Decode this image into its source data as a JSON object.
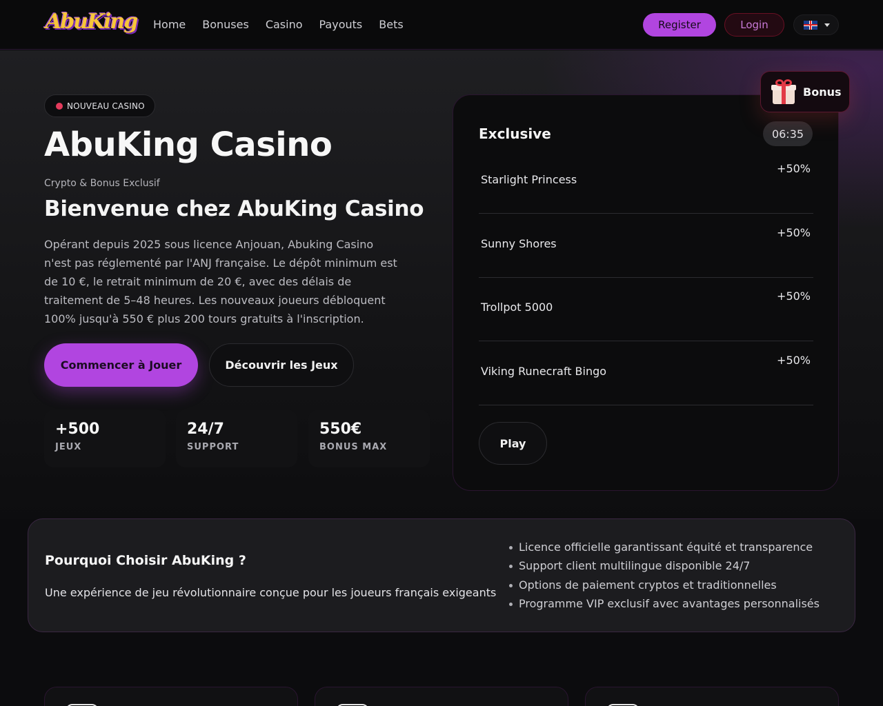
{
  "header": {
    "logo_text": "AbuKing",
    "nav": [
      "Home",
      "Bonuses",
      "Casino",
      "Payouts",
      "Bets"
    ],
    "register_label": "Register",
    "login_label": "Login",
    "language_icon": "uk-flag-icon"
  },
  "hero": {
    "badge": "NOUVEAU CASINO",
    "title": "AbuKing Casino",
    "subtitle": "Crypto & Bonus Exclusif",
    "heading": "Bienvenue chez AbuKing Casino",
    "description": "Opérant depuis 2025 sous licence Anjouan, Abuking Casino n'est pas réglementé par l'ANJ française. Le dépôt minimum est de 10 €, le retrait minimum de 20 €, avec des délais de traitement de 5–48 heures. Les nouveaux joueurs débloquent 100% jusqu'à 550 € plus 200 tours gratuits à l'inscription.",
    "primary_button": "Commencer à Jouer",
    "secondary_button": "Découvrir les Jeux",
    "stats": [
      {
        "value": "+500",
        "label": "JEUX"
      },
      {
        "value": "24/7",
        "label": "SUPPORT"
      },
      {
        "value": "550€",
        "label": "BONUS MAX"
      }
    ]
  },
  "exclusive": {
    "title": "Exclusive",
    "timer": "06:35",
    "bonus_label": "Bonus",
    "games": [
      {
        "name": "Starlight Princess",
        "bonus": "+50%"
      },
      {
        "name": "Sunny Shores",
        "bonus": "+50%"
      },
      {
        "name": "Trollpot 5000",
        "bonus": "+50%"
      },
      {
        "name": "Viking Runecraft Bingo",
        "bonus": "+50%"
      }
    ],
    "play_label": "Play"
  },
  "why": {
    "title": "Pourquoi Choisir AbuKing ?",
    "description": "Une expérience de jeu révolutionnaire conçue pour les joueurs français exigeants",
    "points": [
      "Licence officielle garantissant équité et transparence",
      "Support client multilingue disponible 24/7",
      "Options de paiement cryptos et traditionnelles",
      "Programme VIP exclusif avec avantages personnalisés"
    ]
  },
  "colors": {
    "accent": "#b145e0",
    "background": "#0c0c0e"
  }
}
